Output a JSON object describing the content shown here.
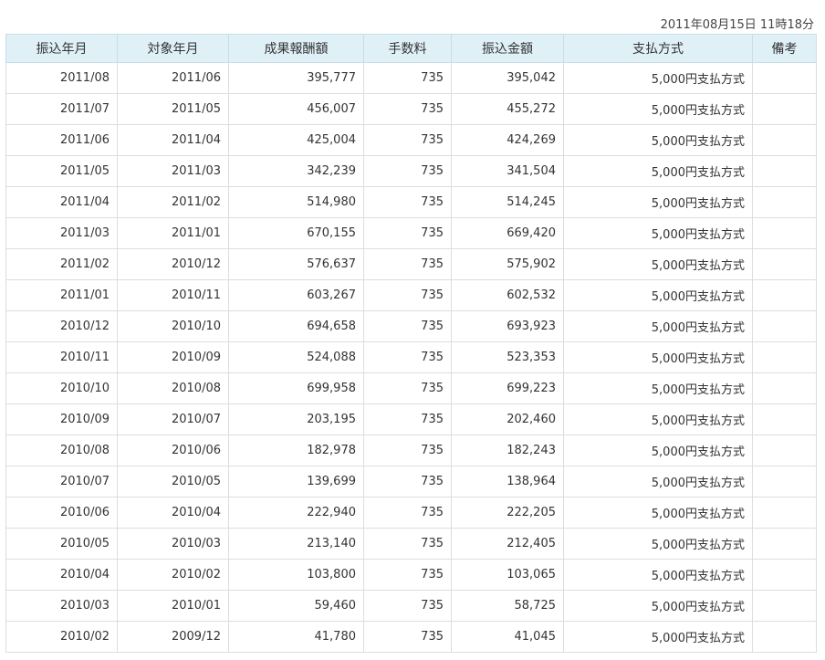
{
  "header": {
    "timestamp": "2011年08月15日 11時18分"
  },
  "table": {
    "columns": [
      "振込年月",
      "対象年月",
      "成果報酬額",
      "手数料",
      "振込金額",
      "支払方式",
      "備考"
    ],
    "rows": [
      [
        "2011/08",
        "2011/06",
        "395,777",
        "735",
        "395,042",
        "5,000円支払方式",
        ""
      ],
      [
        "2011/07",
        "2011/05",
        "456,007",
        "735",
        "455,272",
        "5,000円支払方式",
        ""
      ],
      [
        "2011/06",
        "2011/04",
        "425,004",
        "735",
        "424,269",
        "5,000円支払方式",
        ""
      ],
      [
        "2011/05",
        "2011/03",
        "342,239",
        "735",
        "341,504",
        "5,000円支払方式",
        ""
      ],
      [
        "2011/04",
        "2011/02",
        "514,980",
        "735",
        "514,245",
        "5,000円支払方式",
        ""
      ],
      [
        "2011/03",
        "2011/01",
        "670,155",
        "735",
        "669,420",
        "5,000円支払方式",
        ""
      ],
      [
        "2011/02",
        "2010/12",
        "576,637",
        "735",
        "575,902",
        "5,000円支払方式",
        ""
      ],
      [
        "2011/01",
        "2010/11",
        "603,267",
        "735",
        "602,532",
        "5,000円支払方式",
        ""
      ],
      [
        "2010/12",
        "2010/10",
        "694,658",
        "735",
        "693,923",
        "5,000円支払方式",
        ""
      ],
      [
        "2010/11",
        "2010/09",
        "524,088",
        "735",
        "523,353",
        "5,000円支払方式",
        ""
      ],
      [
        "2010/10",
        "2010/08",
        "699,958",
        "735",
        "699,223",
        "5,000円支払方式",
        ""
      ],
      [
        "2010/09",
        "2010/07",
        "203,195",
        "735",
        "202,460",
        "5,000円支払方式",
        ""
      ],
      [
        "2010/08",
        "2010/06",
        "182,978",
        "735",
        "182,243",
        "5,000円支払方式",
        ""
      ],
      [
        "2010/07",
        "2010/05",
        "139,699",
        "735",
        "138,964",
        "5,000円支払方式",
        ""
      ],
      [
        "2010/06",
        "2010/04",
        "222,940",
        "735",
        "222,205",
        "5,000円支払方式",
        ""
      ],
      [
        "2010/05",
        "2010/03",
        "213,140",
        "735",
        "212,405",
        "5,000円支払方式",
        ""
      ],
      [
        "2010/04",
        "2010/02",
        "103,800",
        "735",
        "103,065",
        "5,000円支払方式",
        ""
      ],
      [
        "2010/03",
        "2010/01",
        "59,460",
        "735",
        "58,725",
        "5,000円支払方式",
        ""
      ],
      [
        "2010/02",
        "2009/12",
        "41,780",
        "735",
        "41,045",
        "5,000円支払方式",
        ""
      ]
    ]
  }
}
